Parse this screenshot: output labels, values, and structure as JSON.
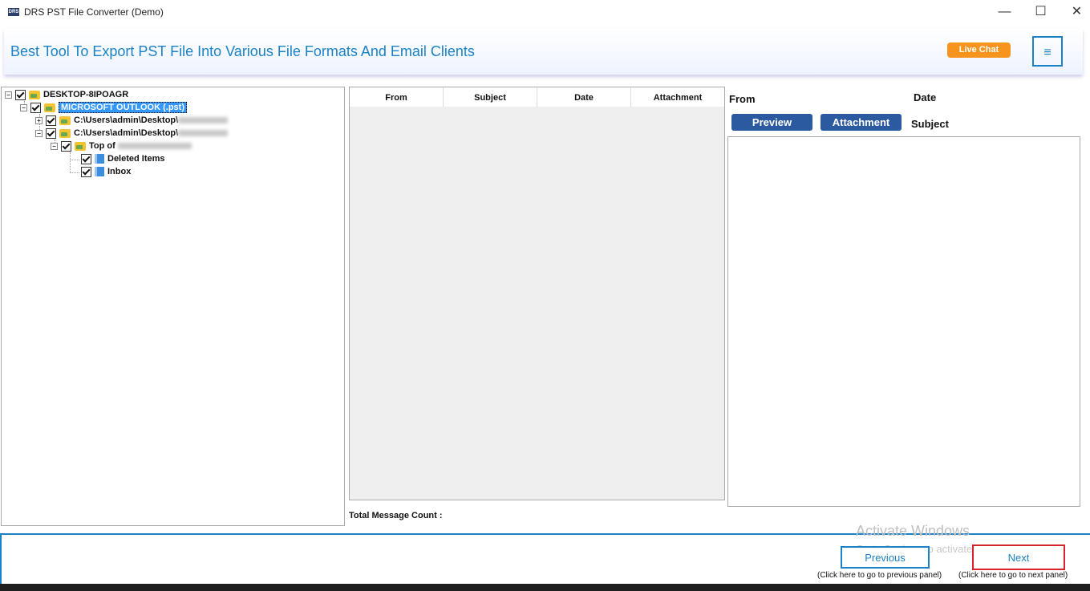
{
  "window": {
    "title": "DRS PST File Converter (Demo)",
    "icon_text": "DRS",
    "minimize": "—",
    "maximize": "☐",
    "close": "✕"
  },
  "banner": {
    "tagline": "Best Tool To Export PST File Into Various File Formats And Email Clients",
    "live_chat": "Live Chat",
    "menu_icon": "≡"
  },
  "tree": {
    "root": "DESKTOP-8IPOAGR",
    "outlook": "MICROSOFT OUTLOOK (.pst)",
    "pst1_prefix": "C:\\Users\\admin\\Desktop\\",
    "pst2_prefix": "C:\\Users\\admin\\Desktop\\",
    "top_of_prefix": "Top of",
    "deleted_items": "Deleted Items",
    "inbox": "Inbox"
  },
  "message_list": {
    "columns": [
      "From",
      "Subject",
      "Date",
      "Attachment"
    ],
    "total_label": "Total Message Count :"
  },
  "preview": {
    "from_label": "From",
    "date_label": "Date",
    "subject_label": "Subject",
    "preview_button": "Preview",
    "attachment_button": "Attachment"
  },
  "navigation": {
    "previous": "Previous",
    "next": "Next",
    "previous_hint": "(Click here to go to previous panel)",
    "next_hint": "(Click here to go to next panel)"
  },
  "watermark": {
    "line1": "Activate Windows",
    "line2": "Go to Settings to activate Windows."
  },
  "colors": {
    "accent": "#1b82c5",
    "live_chat": "#f7941d",
    "button_blue": "#2c5aa0",
    "next_highlight": "#d9232d"
  }
}
